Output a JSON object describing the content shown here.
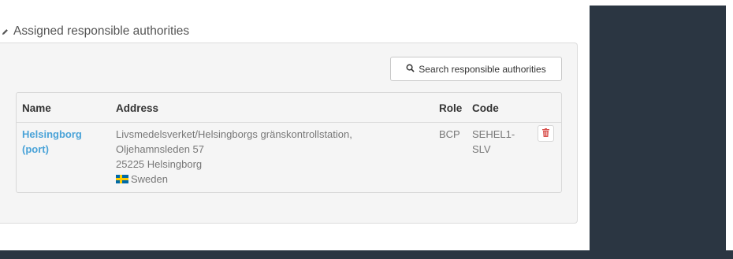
{
  "section": {
    "title": "Assigned responsible authorities",
    "icon": "pencil-icon"
  },
  "search": {
    "label": "Search responsible authorities",
    "icon": "search-icon"
  },
  "table": {
    "headers": {
      "name": "Name",
      "address": "Address",
      "role": "Role",
      "code": "Code"
    },
    "rows": [
      {
        "name_line1": "Helsingborg",
        "name_line2": "(port)",
        "address_line1": "Livsmedelsverket/Helsingborgs gränskontrollstation,",
        "address_line2": "Oljehamnsleden 57",
        "address_line3": "25225 Helsingborg",
        "country": "Sweden",
        "country_flag_icon": "sweden-flag-icon",
        "role": "BCP",
        "code_line1": "SEHEL1-",
        "code_line2": "SLV",
        "delete_icon": "trash-icon"
      }
    ]
  },
  "colors": {
    "link": "#4aa3d8",
    "delete": "#d9534f",
    "dark_bg": "#2b3642",
    "card_bg": "#f5f5f5"
  }
}
